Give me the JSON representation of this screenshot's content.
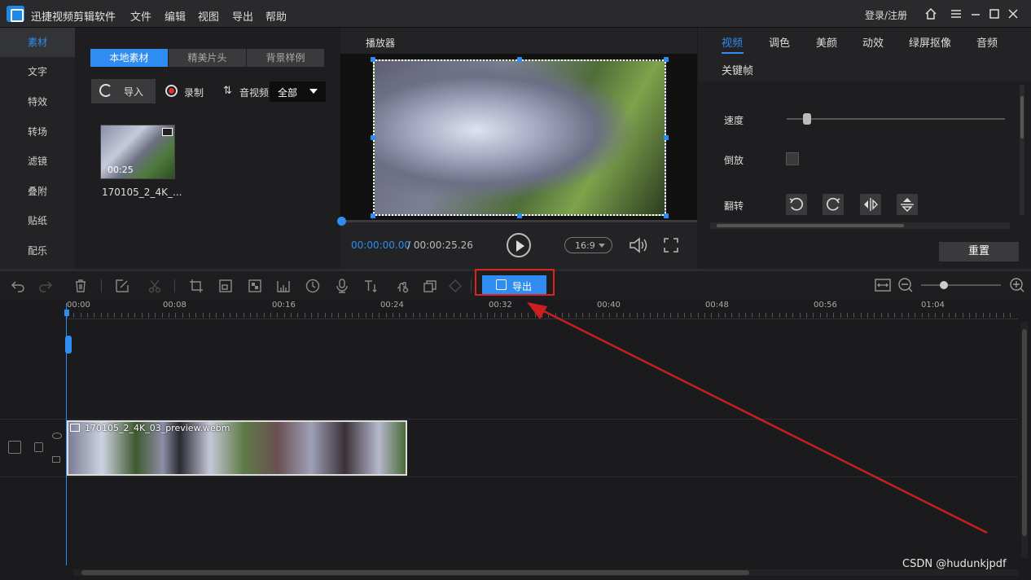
{
  "app": {
    "title": "迅捷视频剪辑软件"
  },
  "menu": [
    "文件",
    "编辑",
    "视图",
    "导出",
    "帮助"
  ],
  "login": "登录/注册",
  "sidebar": {
    "items": [
      "素材",
      "文字",
      "特效",
      "转场",
      "滤镜",
      "叠附",
      "贴纸",
      "配乐"
    ],
    "active": 0
  },
  "library": {
    "tabs": [
      "本地素材",
      "精美片头",
      "背景样例"
    ],
    "import_label": "导入",
    "record_label": "录制",
    "av_label": "音视频",
    "filter_value": "全部",
    "thumb": {
      "duration": "00:25",
      "name": "170105_2_4K_..."
    }
  },
  "player": {
    "title": "播放器",
    "current_time": "00:00:00.00",
    "total_time": "/ 00:00:25.26",
    "ratio": "16:9",
    "progress": 0
  },
  "props": {
    "tabs": [
      "视频",
      "调色",
      "美颜",
      "动效",
      "绿屏抠像",
      "音频",
      "关键帧"
    ],
    "active_tab": 0,
    "speed_label": "速度",
    "reverse_label": "倒放",
    "flip_label": "翻转",
    "reset_label": "重置",
    "speed_value": 0.09
  },
  "toolbar": {
    "export_label": "导出",
    "zoom_level": 0.3
  },
  "ruler": {
    "labels": [
      "00:00",
      "00:08",
      "00:16",
      "00:24",
      "00:32",
      "00:40",
      "00:48",
      "00:56",
      "01:04"
    ]
  },
  "timeline": {
    "clip_name": "170105_2_4K_03_preview.webm"
  },
  "watermark": "CSDN @hudunkjpdf",
  "colors": {
    "accent": "#2f8cf0",
    "highlight": "#dd2222",
    "bg": "#1b1b1d"
  },
  "icons": [
    "undo-icon",
    "redo-icon",
    "delete-icon",
    "edit-icon",
    "split-icon",
    "crop-icon",
    "resize-icon",
    "mosaic-icon",
    "freeze-icon",
    "duration-icon",
    "voice-icon",
    "text-icon",
    "color-icon",
    "overlay-icon",
    "keyframe-icon",
    "fit-icon",
    "zoom-out-icon",
    "zoom-in-icon"
  ]
}
